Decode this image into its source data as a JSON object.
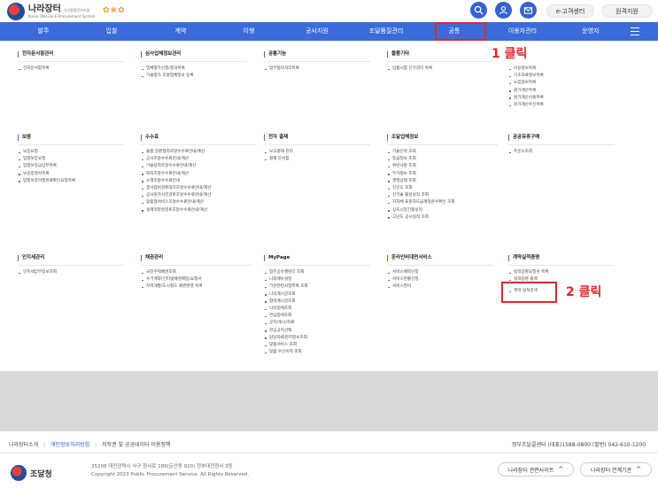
{
  "header": {
    "logo_title": "나라장터",
    "logo_sub": "국가종합전자조달",
    "logo_sub2": "Korea ON-Line E-Procurement System",
    "buttons": [
      {
        "label": "e-고객센터"
      },
      {
        "label": "원격지원"
      }
    ],
    "icons": [
      "search-icon",
      "user-icon",
      "mailbox-icon"
    ]
  },
  "nav": {
    "items": [
      {
        "label": "발주"
      },
      {
        "label": "입찰"
      },
      {
        "label": "계약"
      },
      {
        "label": "이행"
      },
      {
        "label": "공사지원"
      },
      {
        "label": "조달품질관리"
      },
      {
        "label": "공통"
      },
      {
        "label": "이용자관리"
      },
      {
        "label": "운영자"
      }
    ]
  },
  "annotations": {
    "step1": "1 클릭",
    "step2": "2 클릭"
  },
  "menu": {
    "row1": [
      {
        "title": "전자문서함관리",
        "items": [
          "전자문서함목록"
        ]
      },
      {
        "title": "심사업체정보관리",
        "items": [
          "업체평가신청/결과목록",
          "기술평가 조달업체정보 등록"
        ]
      },
      {
        "title": "공통기능",
        "items": [
          "업무협의처리목록"
        ]
      },
      {
        "title": "물품기타",
        "items": [
          "납품시험 단가관리 목록"
        ]
      },
      {
        "title": "",
        "items": [
          "비용정보목록",
          "기초자료정보목록",
          "노임정보목록",
          "원가계산목록",
          "원가계산산출목록",
          "원가계산수신목록"
        ]
      }
    ],
    "row2": [
      {
        "title": "보증",
        "items": [
          "보증요청",
          "입찰보증요청",
          "입찰보증금납부목록",
          "보증증권서목록",
          "입찰보증이행완료확인요청목록"
        ]
      },
      {
        "title": "수수료",
        "items": [
          "물품 장판형역조달수수료안내/계산",
          "공사조달수수료안내/계산",
          "기술용역조달수수료안내/계산",
          "외자조달수수료안내/계산",
          "소액조달수수료안내",
          "총사업비검토대가조달수수료안내/계산",
          "공사원가사전검토조달수수료안내/계산",
          "맞춤형서비스조달수수료안내/계산",
          "설계적정성검토조달수수료안내/계산"
        ]
      },
      {
        "title": "전자 결재",
        "items": [
          "보고결재 관리",
          "결재 문서함"
        ]
      },
      {
        "title": "조달업체정보",
        "items": [
          "기술인력 조회",
          "등급정보 조회",
          "위반사항 조회",
          "부가정보 조회",
          "경영상태 조회",
          "신인도 조회",
          "신기술 활용실적 조회",
          "지자체 표준하도급계약준수확인 조회",
          "상호시장진출실적",
          "고난도 공사실적 조회"
        ]
      },
      {
        "title": "공공유휴구매",
        "items": [
          "주문소조회"
        ]
      }
    ],
    "row3": [
      {
        "title": "인지세관리",
        "items": [
          "인지세납부정보조회"
        ]
      },
      {
        "title": "채권관리",
        "items": [
          "국민주택채권조회",
          "수기계약(인터넷채권매입)요청서",
          "지역개발/도시철도 채권발행 목록"
        ]
      },
      {
        "title": "MyPage",
        "items": [
          "업무공유캘린더 조회",
          "나의메뉴설정",
          "기관관련사업목록 조회",
          "나의계시글조회",
          "협력계시글조회",
          "나의업체조회",
          "관심업체조회",
          "공지/게시/자료",
          "관심공지선택",
          "담당자ID관리정보조회",
          "맞춤서비스 조회",
          "맞춤 수신이력 조회"
        ]
      },
      {
        "title": "온라인비대면서비스",
        "items": [
          "서비스예약신청",
          "서비스현황신청",
          "서비스현어"
        ]
      },
      {
        "title": "계약실적증명",
        "items": [
          "실적증명요청서 목록",
          "실적증명 출력",
          "계약 실적검색"
        ]
      }
    ]
  },
  "footer": {
    "links": [
      {
        "label": "나라장터소개"
      },
      {
        "label": "개인정보처리방침"
      },
      {
        "label": "저작권 및 공공데이터 이용정책"
      }
    ],
    "contact": "정부조달콜센터 (대표)1588-0800 (팔번) 042-610-1200",
    "logo_text": "조달청",
    "address": "35208 대전광역시 서구 청사로 189(둔산동 920) 정부대전청사 3동",
    "copyright": "Copyright 2023 Public Procurement Service. All Rights Reserved.",
    "btn_related": "나라장터 관련사이트",
    "btn_linked": "나라장터 연계기관"
  }
}
